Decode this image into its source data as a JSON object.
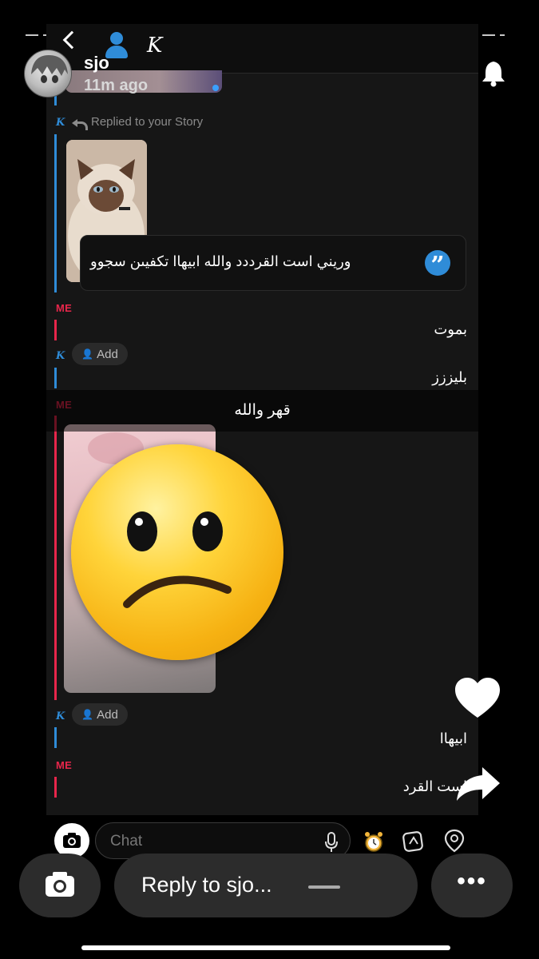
{
  "story": {
    "username": "sjo",
    "time_ago": "11m ago"
  },
  "chat_header": {
    "contact_initial": "K"
  },
  "thread": {
    "replied_label": "Replied to your Story",
    "quote_text": "وريني است القرددد والله ابيهاا تكفيىن سجوو",
    "me_tag": "ME",
    "k_tag": "K",
    "messages": {
      "m1": "بموت",
      "m2": "بليززز",
      "m3": "ابيهاا",
      "m4": "است القرد"
    },
    "add_label": "Add"
  },
  "caption": "قهر والله",
  "composer": {
    "placeholder": "Chat"
  },
  "bottom_bar": {
    "reply_placeholder": "Reply to sjo...",
    "more_label": "•••"
  },
  "icons": {
    "notification": "bell-icon",
    "like": "heart-icon",
    "share": "share-icon",
    "camera": "camera-icon",
    "mic": "microphone-icon",
    "sticker": "sticker-icon",
    "location": "location-pin-icon",
    "timer": "timer-icon"
  },
  "colors": {
    "accent_blue": "#2f8cd8",
    "accent_red": "#e8264b",
    "background": "#000000"
  }
}
